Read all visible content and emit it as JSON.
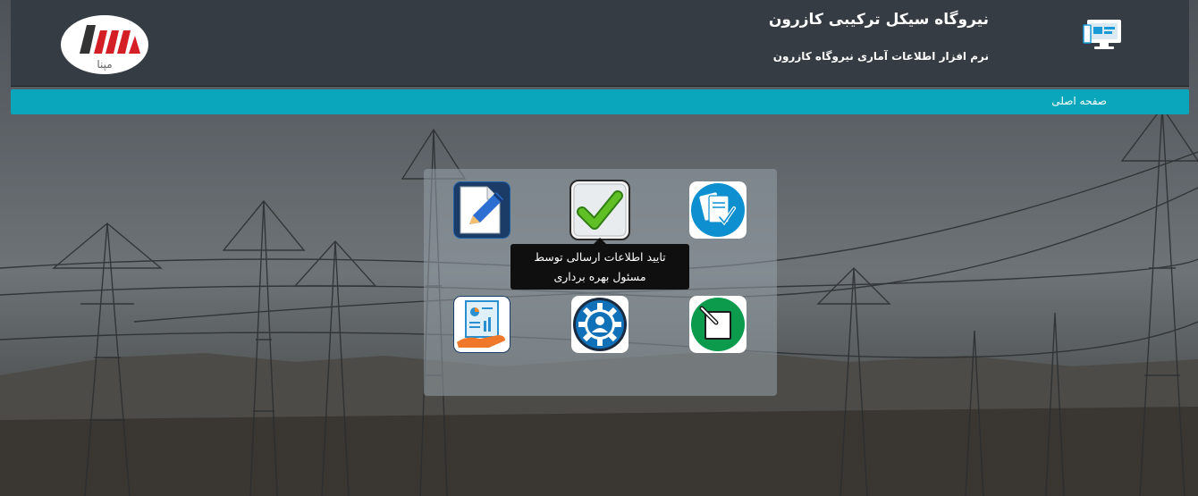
{
  "header": {
    "title": "نیروگاه سیکل ترکیبی کازرون",
    "subtitle": "نرم افزار اطلاعات آماری نیروگاه کازرون",
    "logo_text": "مپنا"
  },
  "navbar": {
    "home_label": "صفحه اصلی"
  },
  "tiles": [
    {
      "name": "documents-check-icon",
      "color": "#0d8fd0"
    },
    {
      "name": "approve-check-icon",
      "color": "#4aa31e"
    },
    {
      "name": "edit-document-icon",
      "color": "#1e5fa8"
    },
    {
      "name": "notepad-edit-icon",
      "color": "#0c9a4c"
    },
    {
      "name": "user-gear-icon",
      "color": "#1070b8"
    },
    {
      "name": "report-hand-icon",
      "color": "#2a8fd0"
    }
  ],
  "tooltip": {
    "line1": "تایید اطلاعات ارسالی توسط",
    "line2": "مسئول بهره برداری"
  },
  "colors": {
    "header_bg": "#353c43",
    "navbar_bg": "#0aa6bc",
    "logo_red": "#d41f26"
  }
}
